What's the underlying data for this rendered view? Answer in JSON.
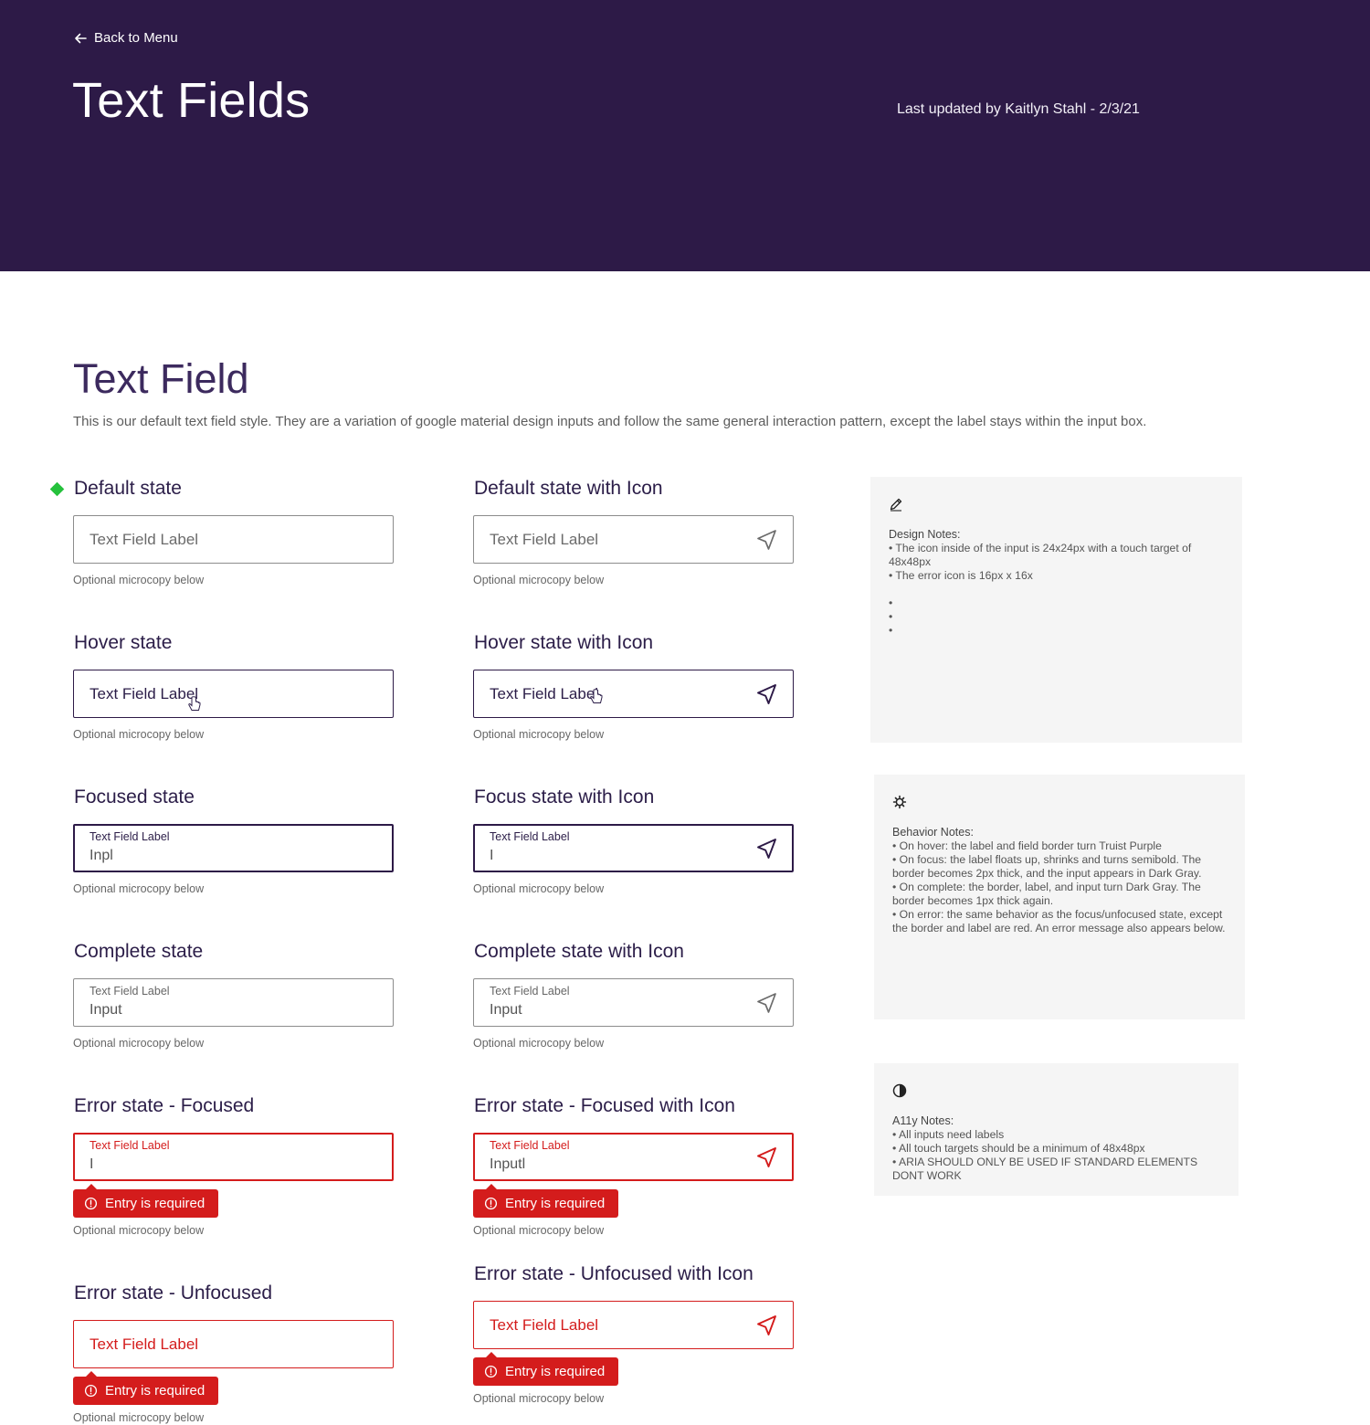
{
  "header": {
    "back_label": "Back to Menu",
    "title": "Text Fields",
    "last_updated": "Last updated by Kaitlyn Stahl - 2/3/21"
  },
  "section": {
    "title": "Text Field",
    "description": "This is our default text field style. They are a variation of google material design inputs and follow the same general interaction pattern, except the label stays within the input box."
  },
  "common": {
    "label": "Text Field Label",
    "microcopy": "Optional microcopy below",
    "error_message": "Entry is required"
  },
  "states": {
    "default": "Default state",
    "default_icon": "Default state with Icon",
    "hover": "Hover state",
    "hover_icon": "Hover state with Icon",
    "focused": "Focused state",
    "focused_icon": "Focus state with Icon",
    "complete": "Complete state",
    "complete_icon": "Complete state with Icon",
    "error_focused": "Error state - Focused",
    "error_focused_icon": "Error state - Focused with Icon",
    "error_unfocused": "Error state - Unfocused",
    "error_unfocused_icon": "Error state - Unfocused with Icon"
  },
  "values": {
    "focused": "Inpl",
    "focused_icon": "I",
    "complete": "Input",
    "complete_icon": "Input",
    "error_focused": "I",
    "error_focused_icon": "Inputl"
  },
  "notes": {
    "design": {
      "icon": "pencil-icon",
      "heading": "Design Notes:",
      "items": [
        "• The icon inside of the input is 24x24px with a touch target of 48x48px",
        "• The error icon is 16px x 16x",
        "",
        "•",
        "•",
        "•"
      ]
    },
    "behavior": {
      "icon": "gear-icon",
      "heading": "Behavior Notes:",
      "items": [
        "• On hover: the label and field border turn Truist Purple",
        "• On focus: the label floats up, shrinks and turns semibold. The border becomes 2px thick, and the input appears in Dark Gray.",
        "• On complete: the border, label, and input turn Dark Gray. The border becomes 1px thick again.",
        "• On error: the same behavior as the focus/unfocused state, except the border and label are red. An error message also appears below."
      ]
    },
    "a11y": {
      "icon": "contrast-icon",
      "heading": "A11y Notes:",
      "items": [
        "• All inputs need labels",
        "• All touch targets should be a minimum of 48x48px",
        "• ARIA SHOULD ONLY BE USED IF STANDARD ELEMENTS DONT WORK"
      ]
    }
  },
  "colors": {
    "brand_purple": "#2d1a47",
    "error_red": "#d41c1c",
    "marker_green": "#25c13c",
    "note_bg": "#f5f5f5"
  }
}
